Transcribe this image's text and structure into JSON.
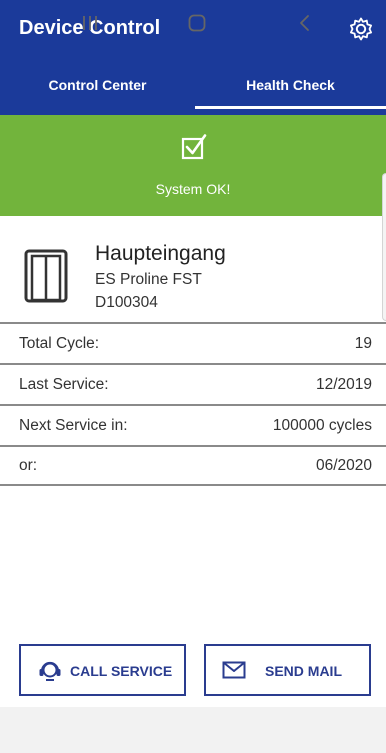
{
  "app_bar": {
    "title": "Device Control",
    "settings_icon": "gear-icon"
  },
  "tabs": [
    {
      "label": "Control Center",
      "selected": false
    },
    {
      "label": "Health Check",
      "selected": true
    }
  ],
  "status": {
    "icon": "check-box-icon",
    "text": "System OK!",
    "color": "#72b43c"
  },
  "device": {
    "icon": "door-icon",
    "name": "Haupteingang",
    "model": "ES Proline FST",
    "serial": "D100304"
  },
  "stats": [
    {
      "label": "Total Cycle:",
      "value": "19"
    },
    {
      "label": "Last Service:",
      "value": "12/2019"
    },
    {
      "label": "Next Service in:",
      "value": "100000 cycles"
    },
    {
      "label": "or:",
      "value": "06/2020"
    }
  ],
  "actions": {
    "call_service": {
      "label": "CALL SERVICE",
      "icon": "headset-icon"
    },
    "send_mail": {
      "label": "SEND MAIL",
      "icon": "mail-icon"
    }
  },
  "colors": {
    "primary": "#1b3a9a",
    "status_ok": "#72b43c",
    "button_text": "#2a3c8f"
  }
}
